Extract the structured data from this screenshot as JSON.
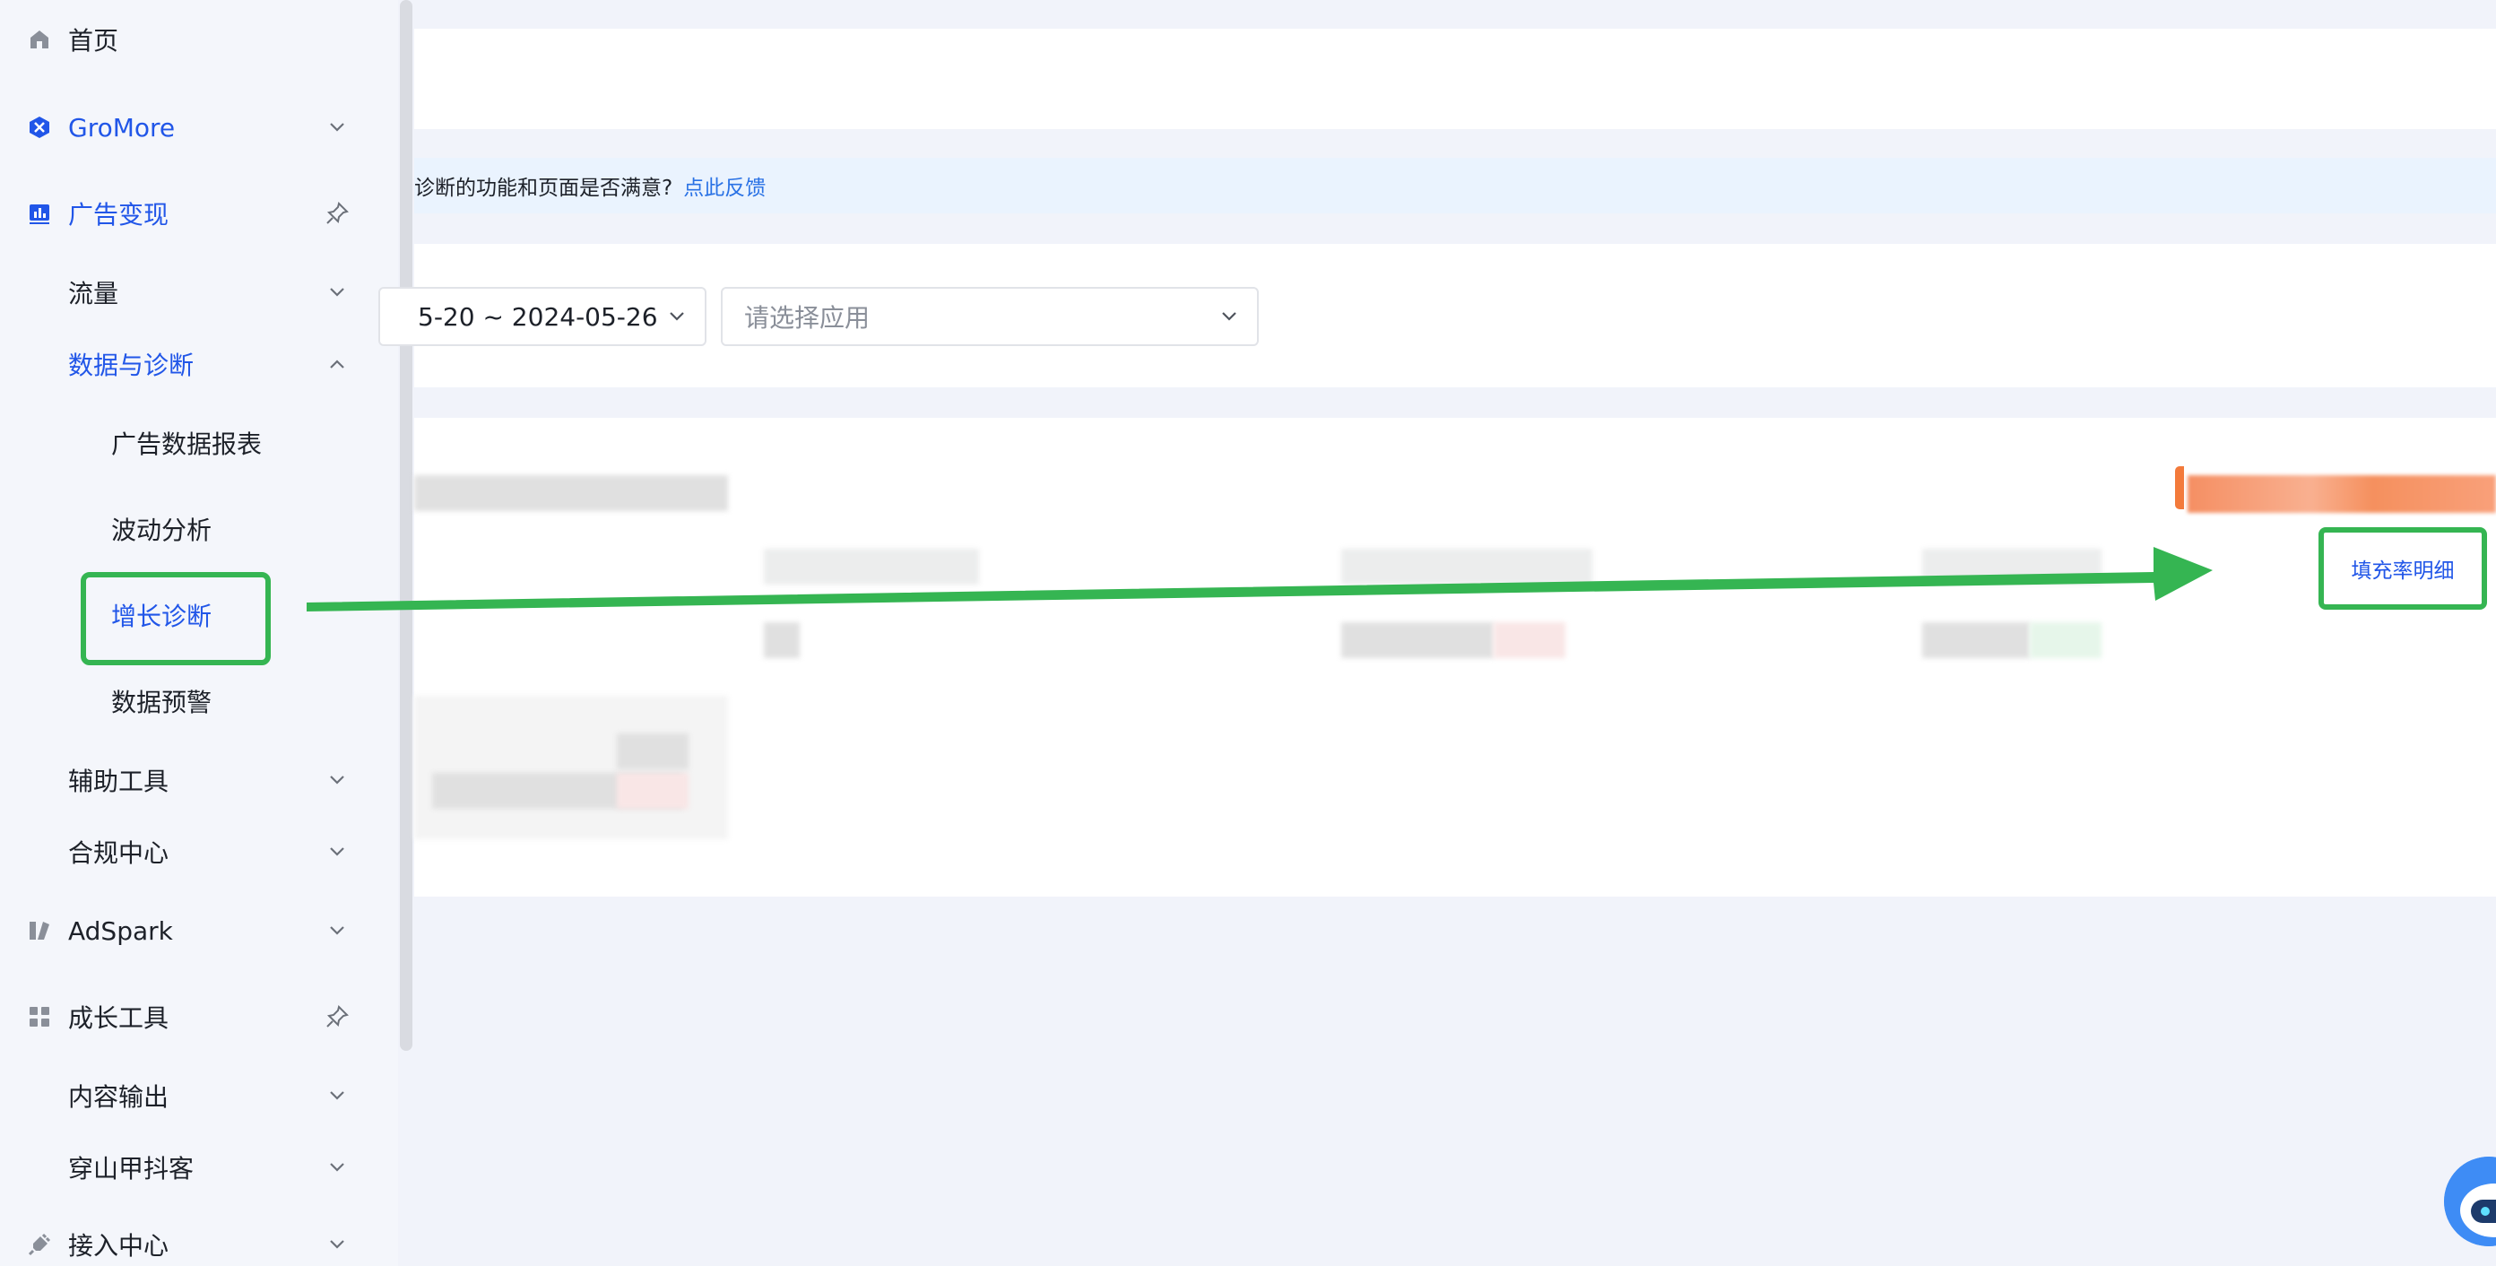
{
  "sidebar": {
    "home": "首页",
    "gromore": "GroMore",
    "ad_monetize": "广告变现",
    "traffic": "流量",
    "data_diag": "数据与诊断",
    "ad_report": "广告数据报表",
    "fluctuation": "波动分析",
    "growth_diag": "增长诊断",
    "data_alert": "数据预警",
    "aux_tools": "辅助工具",
    "compliance": "合规中心",
    "adspark": "AdSpark",
    "growth_tools": "成长工具",
    "content_output": "内容输出",
    "pangolin": "穿山甲抖客",
    "access_center": "接入中心"
  },
  "banner": {
    "text": "诊断的功能和页面是否满意?",
    "link": "点此反馈"
  },
  "filters": {
    "date_range": "5-20 ~ 2024-05-26",
    "app_placeholder": "请选择应用"
  },
  "card": {
    "fill_rate_link": "填充率明细"
  },
  "colors": {
    "accent": "#2156e8",
    "highlight": "#35b552",
    "link": "#2a72e5"
  }
}
